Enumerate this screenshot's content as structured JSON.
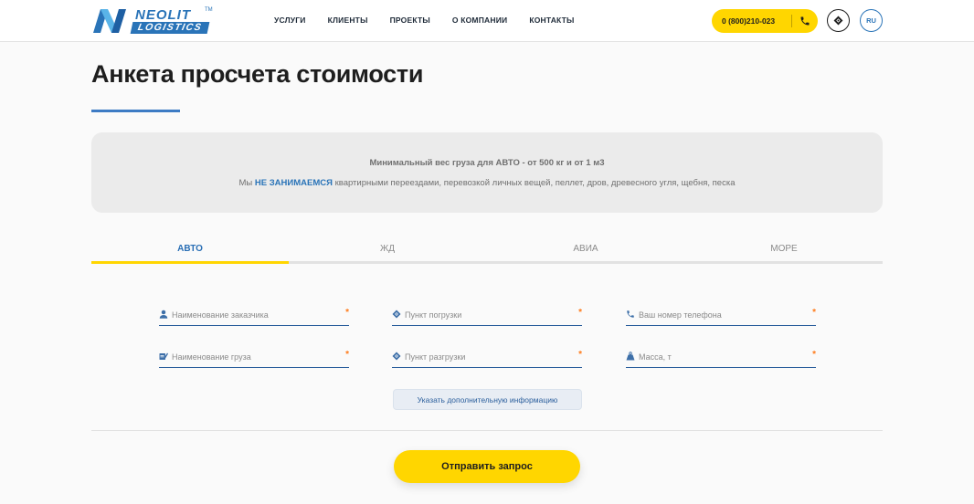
{
  "logo": {
    "top": "NEOLIT",
    "bottom": "LOGISTICS",
    "tm": "TM"
  },
  "nav": [
    {
      "label": "УСЛУГИ"
    },
    {
      "label": "КЛИЕНТЫ"
    },
    {
      "label": "ПРОЕКТЫ"
    },
    {
      "label": "О КОМПАНИИ"
    },
    {
      "label": "КОНТАКТЫ"
    }
  ],
  "header": {
    "phone": "0 (800)210-023",
    "lang": "RU"
  },
  "page": {
    "title": "Анкета просчета стоимости"
  },
  "notice": {
    "line1": "Минимальный вес груза для АВТО - от 500 кг и от 1 м3",
    "line2_prefix": "Мы ",
    "line2_strong": "НЕ ЗАНИМАЕМСЯ",
    "line2_suffix": " квартирными переездами, перевозкой личных вещей, пеллет, дров, древесного угля, щебня, песка"
  },
  "tabs": [
    {
      "label": "АВТО",
      "active": true
    },
    {
      "label": "ЖД",
      "active": false
    },
    {
      "label": "АВИА",
      "active": false
    },
    {
      "label": "МОРЕ",
      "active": false
    }
  ],
  "form": {
    "customer_placeholder": "Наименование заказчика",
    "loading_placeholder": "Пункт погрузки",
    "phone_placeholder": "Ваш номер телефона",
    "cargo_placeholder": "Наименование груза",
    "unloading_placeholder": "Пункт разгрузки",
    "weight_placeholder": "Масса, т",
    "required_mark": "*",
    "extra_label": "Указать дополнительную информацию",
    "submit_label": "Отправить запрос"
  },
  "colors": {
    "accent": "#ffd600",
    "brand": "#2a74b8",
    "required": "#ff7a1a"
  }
}
